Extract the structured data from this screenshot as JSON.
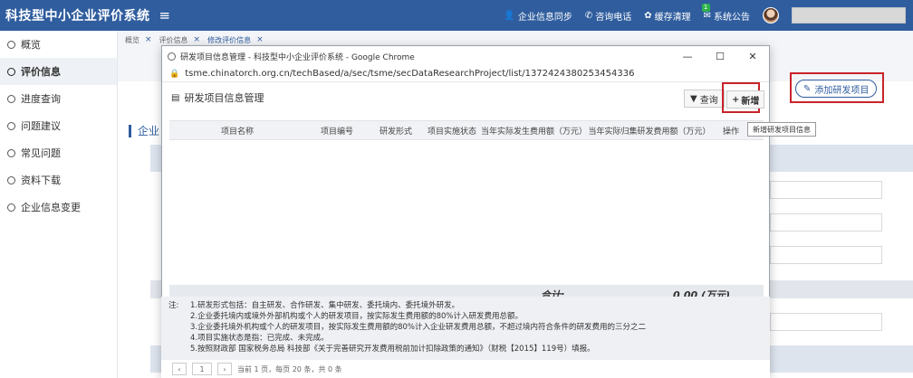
{
  "topbar": {
    "title": "科技型中小企业评价系统",
    "menu_icon": "hamburger-icon",
    "nav": [
      {
        "label": "企业信息同步",
        "icon": "user-icon"
      },
      {
        "label": "咨询电话",
        "icon": "phone-icon"
      },
      {
        "label": "缓存清理",
        "icon": "gear-icon"
      },
      {
        "label": "系统公告",
        "icon": "mail-icon",
        "badge": "1"
      }
    ]
  },
  "sidebar": {
    "items": [
      {
        "label": "概览"
      },
      {
        "label": "评价信息"
      },
      {
        "label": "进度查询"
      },
      {
        "label": "问题建议"
      },
      {
        "label": "常见问题"
      },
      {
        "label": "资料下载"
      },
      {
        "label": "企业信息变更"
      }
    ],
    "active_index": 1
  },
  "main": {
    "tabs": [
      {
        "label": "概览"
      },
      {
        "label": "评价信息"
      },
      {
        "label": "修改评价信息"
      }
    ],
    "section_title": "企业",
    "add_rd_label": "添加研发项目"
  },
  "popup": {
    "window_title": "研发项目信息管理 - 科技型中小企业评价系统 - Google Chrome",
    "url": "tsme.chinatorch.org.cn/techBased/a/sec/tsme/secDataResearchProject/list/1372424380253454336",
    "header_title": "研发项目信息管理",
    "query_label": "查询",
    "add_label": "新增",
    "tooltip": "新增研发项目信息",
    "columns": [
      "项目名称",
      "项目编号",
      "研发形式",
      "项目实施状态",
      "当年实际发生费用额（万元）",
      "当年实际归集研发费用额（万元）",
      "操作"
    ],
    "sum_label": "合计:",
    "sum_value": "0.00 (万元)",
    "notes_label": "注:",
    "notes": [
      "1.研发形式包括：自主研发、合作研发、集中研发、委托境内、委托境外研发。",
      "2.企业委托境内或境外外部机构或个人的研发项目，按实际发生费用额的80%计入研发费用总额。",
      "3.企业委托境外机构或个人的研发项目，按实际发生费用额的80%计入企业研发费用总额，不超过境内符合条件的研发费用的三分之二",
      "4.项目实施状态是指：已完成、未完成。",
      "5.按照财政部 国家税务总局 科技部《关于完善研究开发费用税前加计扣除政策的通知》（财税【2015】119号）填报。"
    ],
    "pager": {
      "prev": "‹",
      "current": "1",
      "next": "›",
      "summary": "当前 1 页，每页 20 条，共 0 条"
    }
  },
  "colors": {
    "brand": "#2f5d9e",
    "highlight": "#c9232a"
  }
}
